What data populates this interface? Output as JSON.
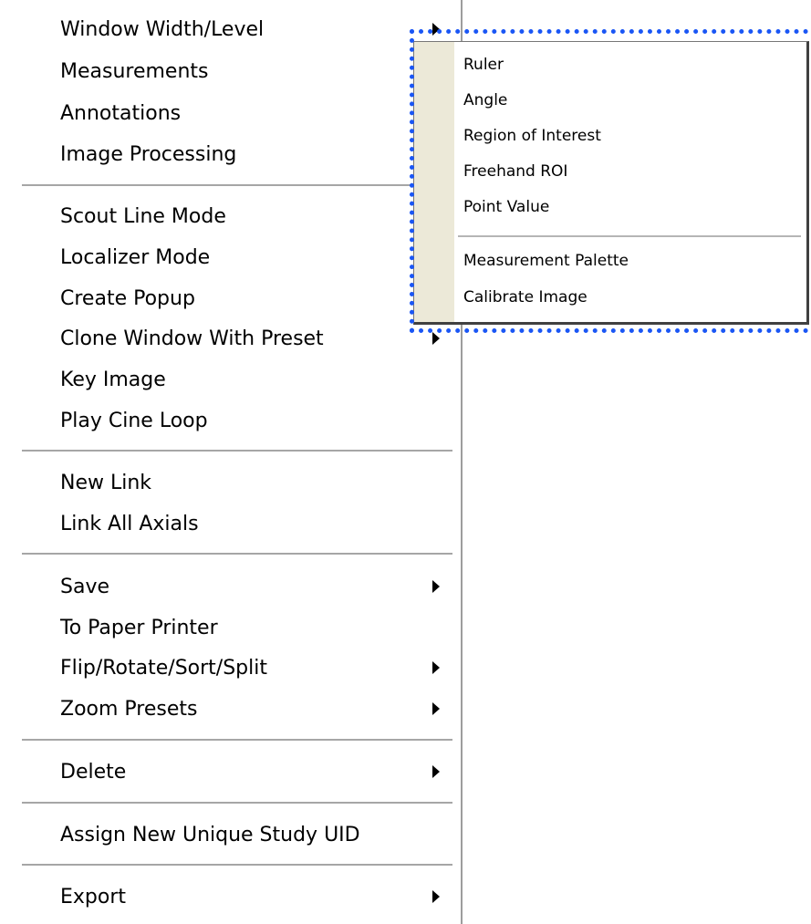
{
  "main_menu": {
    "items": [
      {
        "label": "Window Width/Level",
        "has_submenu": true
      },
      {
        "label": "Measurements",
        "has_submenu": false
      },
      {
        "label": "Annotations",
        "has_submenu": false
      },
      {
        "label": "Image Processing",
        "has_submenu": false
      },
      {
        "label": "Scout Line Mode",
        "has_submenu": false
      },
      {
        "label": "Localizer Mode",
        "has_submenu": false
      },
      {
        "label": "Create Popup",
        "has_submenu": false
      },
      {
        "label": "Clone Window With Preset",
        "has_submenu": true
      },
      {
        "label": "Key Image",
        "has_submenu": false
      },
      {
        "label": "Play Cine Loop",
        "has_submenu": false
      },
      {
        "label": "New Link",
        "has_submenu": false
      },
      {
        "label": "Link All Axials",
        "has_submenu": false
      },
      {
        "label": "Save",
        "has_submenu": true
      },
      {
        "label": "To Paper Printer",
        "has_submenu": false
      },
      {
        "label": "Flip/Rotate/Sort/Split",
        "has_submenu": true
      },
      {
        "label": "Zoom Presets",
        "has_submenu": true
      },
      {
        "label": "Delete",
        "has_submenu": true
      },
      {
        "label": "Assign New Unique Study UID",
        "has_submenu": false
      },
      {
        "label": "Export",
        "has_submenu": true
      }
    ]
  },
  "measurements_submenu": {
    "items": [
      {
        "label": "Ruler"
      },
      {
        "label": "Angle"
      },
      {
        "label": "Region of Interest"
      },
      {
        "label": "Freehand ROI"
      },
      {
        "label": "Point Value"
      },
      {
        "label": "Measurement Palette"
      },
      {
        "label": "Calibrate Image"
      }
    ]
  },
  "colors": {
    "highlight_border": "#1a56f5",
    "submenu_gutter": "#ece9d8",
    "separator": "#a6a6a6"
  }
}
